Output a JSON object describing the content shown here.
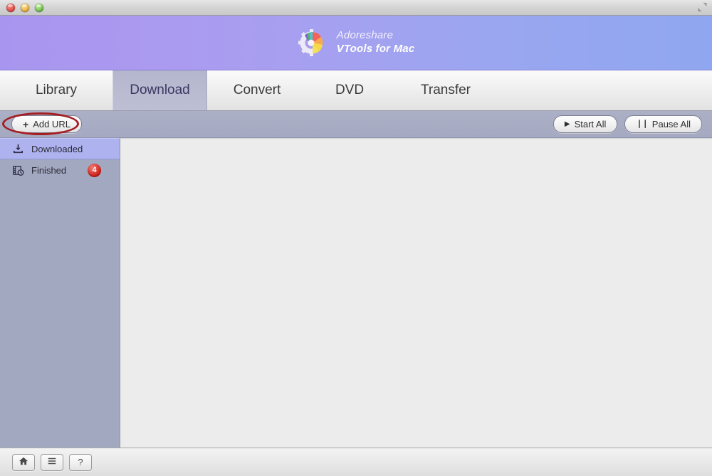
{
  "window": {
    "traffic_lights": [
      {
        "name": "close",
        "color": "#de4b45"
      },
      {
        "name": "minimize",
        "color": "#e8ae3c"
      },
      {
        "name": "zoom",
        "color": "#6fbf4e"
      }
    ],
    "fullscreen_icon": "fullscreen-icon"
  },
  "brand": {
    "logo_icon": "adoreshare-gear-logo",
    "company": "Adoreshare",
    "product": "VTools for Mac",
    "gradient_from": "#a795ef",
    "gradient_to": "#8fa7f0"
  },
  "tabs": [
    {
      "label": "Library",
      "active": false,
      "name": "tab-library"
    },
    {
      "label": "Download",
      "active": true,
      "name": "tab-download"
    },
    {
      "label": "Convert",
      "active": false,
      "name": "tab-convert"
    },
    {
      "label": "DVD",
      "active": false,
      "name": "tab-dvd"
    },
    {
      "label": "Transfer",
      "active": false,
      "name": "tab-transfer"
    }
  ],
  "toolbar": {
    "add_url_label": "Add URL",
    "add_url_glyph": "+",
    "start_all_label": "Start All",
    "start_all_glyph": "▶",
    "pause_all_label": "Pause All",
    "pause_all_glyph": "❘❘",
    "highlight_color": "#a41e22",
    "highlight_target": "add-url-button"
  },
  "sidebar": {
    "background": "#a3a8c1",
    "selected_background": "#aeb2ef",
    "items": [
      {
        "label": "Downloaded",
        "icon": "download-tray-icon",
        "selected": true,
        "badge": null
      },
      {
        "label": "Finished",
        "icon": "film-clock-icon",
        "selected": false,
        "badge": "4",
        "badge_color": "#d6251f"
      }
    ]
  },
  "content": {
    "background": "#ececec",
    "items": []
  },
  "bottombar": {
    "buttons": [
      {
        "name": "home-button",
        "icon": "home-icon",
        "glyph": ""
      },
      {
        "name": "menu-button",
        "icon": "hamburger-menu-icon",
        "glyph": ""
      },
      {
        "name": "help-button",
        "icon": "question-mark-icon",
        "glyph": "?"
      }
    ]
  }
}
